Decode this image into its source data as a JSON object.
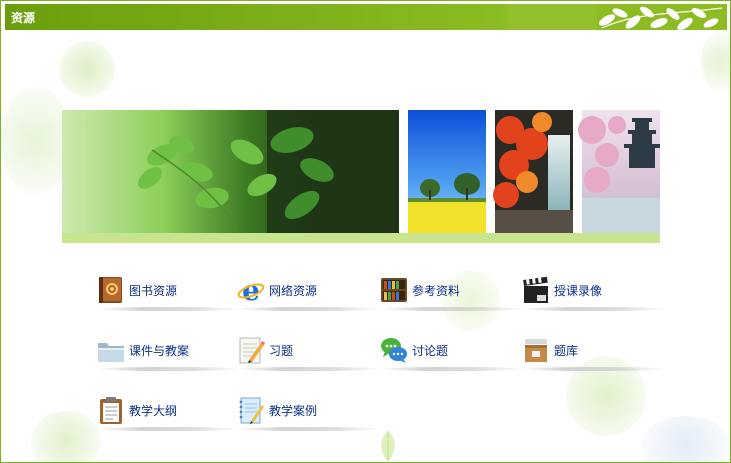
{
  "header": {
    "title": "资源"
  },
  "banner": {
    "main_image": "green-leaves-tree-photo",
    "thumbnails": [
      "blue-sky-rapeseed-field-photo",
      "red-maple-waterfall-photo",
      "cherry-blossom-pagoda-photo"
    ]
  },
  "colors": {
    "accent": "#7ab31c",
    "link": "#0b2f86",
    "banner_bar": "#c9e48f"
  },
  "resources": [
    {
      "label": "图书资源",
      "icon": "book-icon"
    },
    {
      "label": "网络资源",
      "icon": "internet-explorer-icon"
    },
    {
      "label": "参考资料",
      "icon": "bookshelf-icon"
    },
    {
      "label": "授课录像",
      "icon": "clapperboard-icon"
    },
    {
      "label": "课件与教案",
      "icon": "folder-icon"
    },
    {
      "label": "习题",
      "icon": "notepad-pencil-icon"
    },
    {
      "label": "讨论题",
      "icon": "chat-bubbles-icon"
    },
    {
      "label": "题库",
      "icon": "archive-box-icon"
    },
    {
      "label": "教学大纲",
      "icon": "clipboard-icon"
    },
    {
      "label": "教学案例",
      "icon": "notebook-pencil-icon"
    }
  ]
}
